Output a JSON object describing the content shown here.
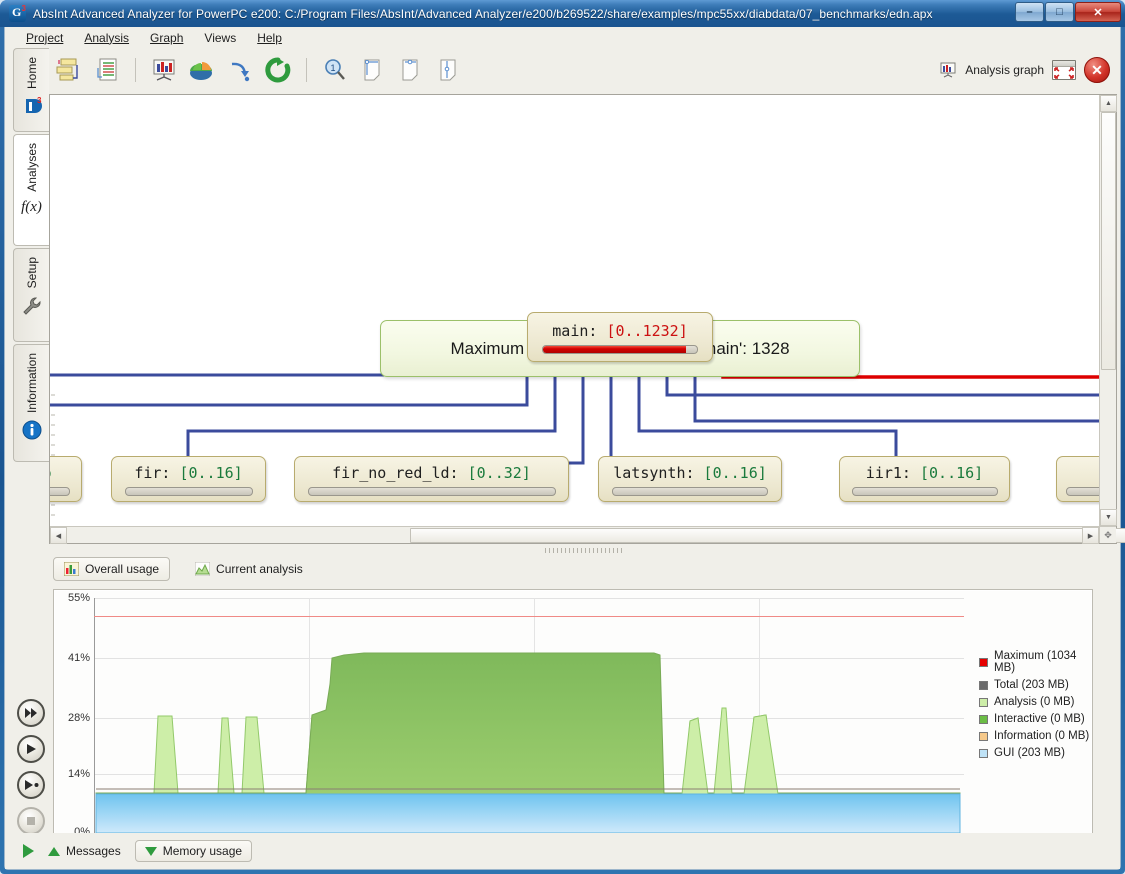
{
  "window": {
    "title": "AbsInt Advanced Analyzer for PowerPC e200: C:/Program Files/AbsInt/Advanced Analyzer/e200/b269522/share/examples/mpc55xx/diabdata/07_benchmarks/edn.apx",
    "minimize_label": "–",
    "maximize_label": "□",
    "close_label": "✕"
  },
  "menubar": {
    "items": [
      {
        "label": "Project"
      },
      {
        "label": "Analysis"
      },
      {
        "label": "Graph"
      },
      {
        "label": "Views"
      },
      {
        "label": "Help"
      }
    ]
  },
  "toolbar": {
    "buttons": [
      {
        "name": "project-tree-icon",
        "tooltip": "Project"
      },
      {
        "name": "report-icon",
        "tooltip": "Report"
      },
      {
        "name": "presentation-chart-icon",
        "tooltip": "Analysis graph"
      },
      {
        "name": "pie-chart-icon",
        "tooltip": "Pie chart"
      },
      {
        "name": "arrow-down-right-icon",
        "tooltip": "Go to"
      },
      {
        "name": "refresh-icon",
        "tooltip": "Reanalyze"
      },
      {
        "name": "zoom-one-icon",
        "tooltip": "Zoom 1:1"
      },
      {
        "name": "fit-page-icon",
        "tooltip": "Fit page"
      },
      {
        "name": "fit-width-icon",
        "tooltip": "Fit width"
      },
      {
        "name": "fit-height-icon",
        "tooltip": "Fit height"
      }
    ],
    "analysis_graph_label": "Analysis graph",
    "maximize_view_label": "",
    "close_view_label": ""
  },
  "sidebar": {
    "tabs": [
      {
        "label": "Home",
        "icon": "absint-logo-icon",
        "active": false
      },
      {
        "label": "Analyses",
        "icon": "fx-icon",
        "active": true
      },
      {
        "label": "Setup",
        "icon": "wrench-icon",
        "active": false
      },
      {
        "label": "Information",
        "icon": "info-icon",
        "active": false
      }
    ]
  },
  "graph": {
    "header": "Maximum Stack Usage for Entry 'main': 1328",
    "root": {
      "name": "main:",
      "range": "[0..1232]",
      "bar_percent": 93,
      "bar_color": "#d40000"
    },
    "children": [
      {
        "name": "fir:",
        "range": "[0..16]",
        "partial": false
      },
      {
        "name": "fir_no_red_ld:",
        "range": "[0..32]",
        "partial": false
      },
      {
        "name": "latsynth:",
        "range": "[0..16]",
        "partial": false
      },
      {
        "name": "iir1:",
        "range": "[0..16]",
        "partial": false
      },
      {
        "name": "co",
        "range": "",
        "partial": true
      }
    ],
    "edge_color_normal": "#3b4b9c",
    "edge_color_highlight": "#dd0000",
    "scroll": {
      "h_left_arrow": "◀",
      "h_right_arrow": "▶",
      "v_up_arrow": "▲",
      "v_down_arrow": "▼",
      "resize_grip": "✥"
    }
  },
  "bottom_tabs": [
    {
      "label": "Overall usage",
      "icon": "bar-chart-icon",
      "active": true
    },
    {
      "label": "Current analysis",
      "icon": "area-chart-icon",
      "active": false
    }
  ],
  "chart_data": {
    "type": "area",
    "title": "",
    "xlabel": "",
    "ylabel": "",
    "ylim": [
      0,
      55
    ],
    "yticks": [
      0,
      14,
      28,
      41,
      55
    ],
    "ytick_labels": [
      "0%",
      "14%",
      "28%",
      "41%",
      "55%"
    ],
    "grid": true,
    "legend_position": "right",
    "max_line_value": 51,
    "legend": [
      {
        "label": "Maximum (1034 MB)",
        "color": "#e50000"
      },
      {
        "label": "Total (203 MB)",
        "color": "#6b6b6b"
      },
      {
        "label": "Analysis (0 MB)",
        "color": "#cdeea8"
      },
      {
        "label": "Interactive (0 MB)",
        "color": "#6bbd45"
      },
      {
        "label": "Information (0 MB)",
        "color": "#f6c98a"
      },
      {
        "label": "GUI (203 MB)",
        "color": "#bfe3f7"
      }
    ],
    "series": [
      {
        "name": "GUI (203 MB)",
        "color": "#bfe3f7",
        "x": [
          0,
          100
        ],
        "values": [
          9.5,
          9.5
        ]
      },
      {
        "name": "Total (203 MB)",
        "color": "#6b6b6b",
        "x": [
          0,
          100
        ],
        "values": [
          10,
          10
        ]
      },
      {
        "name": "Interactive (0 MB)",
        "color": "#8cc25a",
        "x": [
          0,
          7,
          9,
          12,
          14,
          24,
          27,
          29,
          31,
          34,
          36,
          43,
          47,
          50,
          52,
          55,
          58,
          60,
          62,
          77,
          79,
          82,
          84,
          86,
          88,
          90,
          92,
          95,
          100
        ],
        "values": [
          9.6,
          9.6,
          26.5,
          26.5,
          9.6,
          9.6,
          27,
          27,
          9.6,
          9.6,
          26.8,
          26.8,
          9.6,
          9.6,
          27.3,
          27.3,
          44.5,
          44.5,
          44.5,
          44.5,
          9.6,
          9.6,
          19.5,
          9.6,
          21.0,
          9.6,
          19.5,
          9.6,
          9.6
        ]
      }
    ],
    "shape_note": "Stacked memory usage over time: light-blue GUI baseline ~9.5%, green analysis spikes peaking ~27% and two wide plateaus ~44.5%, red maximum reference line near 51%"
  },
  "transport": {
    "buttons": [
      {
        "name": "fast-forward-button",
        "glyph": "▶▶",
        "enabled": true
      },
      {
        "name": "play-button",
        "glyph": "▶",
        "enabled": true
      },
      {
        "name": "step-button",
        "glyph": "▶•",
        "enabled": true
      },
      {
        "name": "stop-button",
        "glyph": "■",
        "enabled": false
      }
    ]
  },
  "statusbar": {
    "run_icon": "play-icon",
    "messages_label": "Messages",
    "memory_usage_label": "Memory usage"
  }
}
